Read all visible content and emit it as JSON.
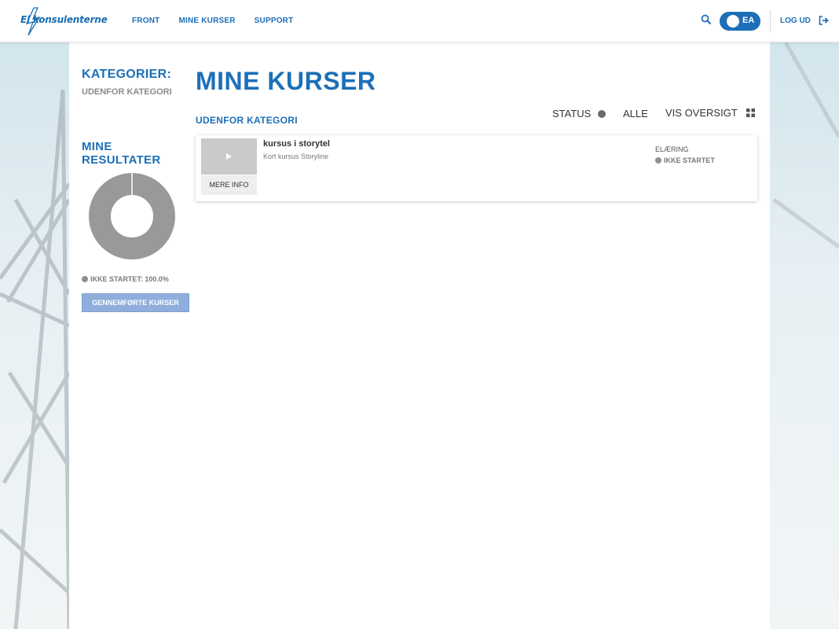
{
  "header": {
    "logo_text": "El konsulenterne",
    "nav": [
      "FRONT",
      "MINE KURSER",
      "SUPPORT"
    ],
    "toggle_label": "EA",
    "logout_label": "LOG UD",
    "accent": "#1d6fb8"
  },
  "sidebar": {
    "title": "KATEGORIER:",
    "category": "UDENFOR KATEGORI",
    "results_title": "MINE RESULTATER",
    "legend": "IKKE STARTET: 100.0%",
    "not_started_percent": 100.0,
    "completed_button": "GENNEMFØRTE KURSER"
  },
  "main": {
    "title": "MINE KURSER",
    "status_label": "STATUS",
    "all_label": "ALLE",
    "overview_label": "VIS OVERSIGT",
    "section_title": "UDENFOR KATEGORI",
    "courses": [
      {
        "title": "kursus i storytel",
        "description": "Kort kursus Storyline",
        "info_button": "MERE INFO",
        "type": "ELÆRING",
        "status": "IKKE STARTET"
      }
    ]
  },
  "icons": [
    "search-icon",
    "logout-icon",
    "grid-icon",
    "play-icon"
  ]
}
